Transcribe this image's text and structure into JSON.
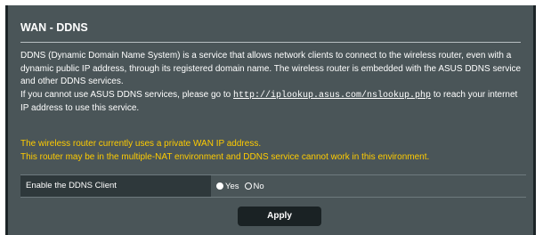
{
  "title": "WAN - DDNS",
  "description": {
    "line1": "DDNS (Dynamic Domain Name System) is a service that allows network clients to connect to the wireless router, even with a dynamic public IP address, through its registered domain name. The wireless router is embedded with the ASUS DDNS service and other DDNS services.",
    "line2_before": "If you cannot use ASUS DDNS services, please go to ",
    "line2_link": "http://iplookup.asus.com/nslookup.php",
    "line2_after": " to reach your internet IP address to use this service."
  },
  "warnings": {
    "line1": "The wireless router currently uses a private WAN IP address.",
    "line2": "This router may be in the multiple-NAT environment and DDNS service cannot work in this environment."
  },
  "ddns_client": {
    "label": "Enable the DDNS Client",
    "options": [
      {
        "label": "Yes",
        "checked": true
      },
      {
        "label": "No",
        "checked": false
      }
    ]
  },
  "apply_label": "Apply",
  "colors": {
    "panel_bg": "#4a5558",
    "warning_text": "#ffcc00",
    "button_bg": "#1a2224"
  }
}
